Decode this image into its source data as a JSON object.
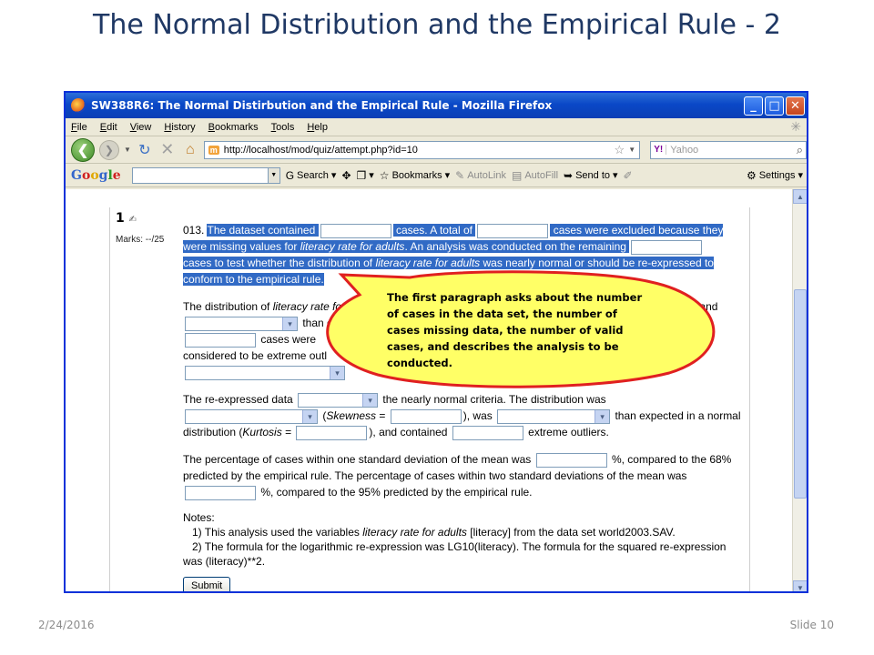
{
  "slide": {
    "title": "The Normal Distribution and the Empirical Rule - 2",
    "date": "2/24/2016",
    "slide_number": "Slide 10"
  },
  "window": {
    "title": "SW388R6: The Normal Distirbution and the Empirical Rule - Mozilla Firefox",
    "minimize": "_",
    "maximize": "□",
    "close": "✕"
  },
  "menu": [
    "File",
    "Edit",
    "View",
    "History",
    "Bookmarks",
    "Tools",
    "Help"
  ],
  "nav": {
    "url": "http://localhost/mod/quiz/attempt.php?id=10",
    "favicon": "m",
    "search_placeholder": "Yahoo",
    "search_engine": "Y!"
  },
  "google_toolbar": {
    "logo": "Google",
    "search": "Search",
    "bookmarks": "Bookmarks",
    "autolink": "AutoLink",
    "autofill": "AutoFill",
    "sendto": "Send to",
    "settings": "Settings"
  },
  "quiz": {
    "number": "1",
    "marks": "Marks: --/25",
    "question_id": "013.",
    "p1": {
      "a": "The dataset contained",
      "b": "cases. A total of",
      "c": "cases were excluded because they",
      "d1": "were missing values for ",
      "d2": "literacy rate for adults",
      "d3": ". An analysis was conducted on the remaining",
      "e1": "cases to test whether the distribution of ",
      "e2": "literacy rate for adults",
      "e3": " was nearly normal or should be re-expressed to",
      "f": "conform to the empirical rule."
    },
    "p2": {
      "a1": "The distribution of ",
      "a2": "literacy rate for",
      "a3": ") and",
      "b": "than e",
      "c": "cases were",
      "d": "considered to be extreme outl"
    },
    "p3": {
      "a1": "The re-expressed data",
      "a2": "the nearly normal criteria. The distribution was",
      "b1": "(",
      "b2": "Skewness",
      "b3": " =",
      "b4": "), was",
      "b5": "than expected in a normal",
      "c1": "distribution (",
      "c2": "Kurtosis",
      "c3": " =",
      "c4": "), and contained",
      "c5": "extreme outliers."
    },
    "p4": {
      "a1": "The percentage of cases within one standard deviation of the mean was",
      "a2": "%, compared to the 68%",
      "b": "predicted by the empirical rule. The percentage of cases within two standard deviations of the mean was",
      "c": "%, compared to the 95% predicted by the empirical rule."
    },
    "notes": {
      "heading": "Notes:",
      "n1a": "1) This analysis used the variables ",
      "n1b": "literacy rate for adults",
      "n1c": " [literacy] from the data set world2003.SAV.",
      "n2": "2) The formula for the logarithmic re-expression was LG10(literacy). The formula for the squared re-expression",
      "n3": "was (literacy)**2."
    },
    "submit": "Submit"
  },
  "callout": {
    "text": "The first paragraph asks about the number of cases in the data set, the number of cases missing data, the number of valid cases, and describes the analysis to be conducted.",
    "fill": "#ffff66",
    "stroke": "#e02020"
  }
}
